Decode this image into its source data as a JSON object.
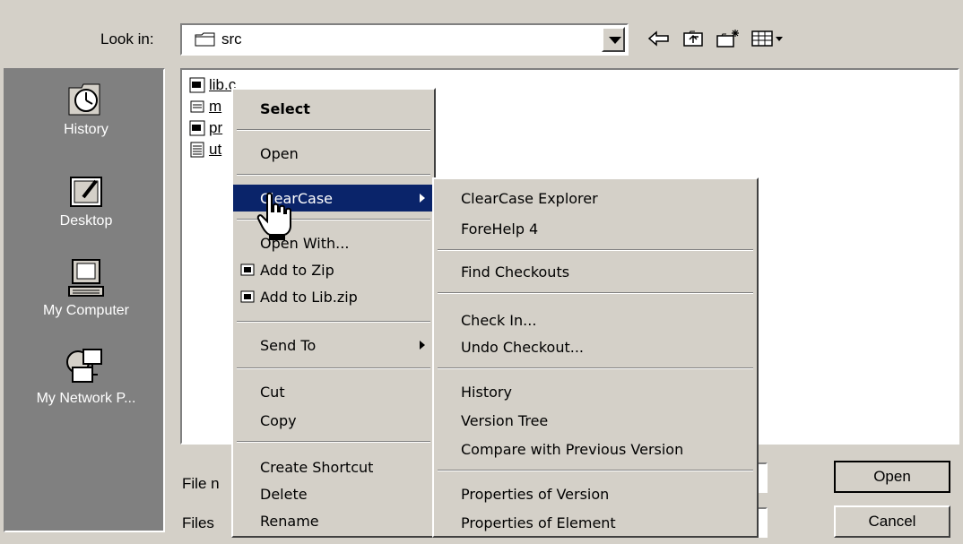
{
  "look_in": {
    "label": "Look in:",
    "value": "src"
  },
  "toolbar_icons": [
    "back-arrow-icon",
    "up-folder-icon",
    "new-folder-icon",
    "view-menu-icon"
  ],
  "places": [
    {
      "label": "History",
      "icon": "history-icon"
    },
    {
      "label": "Desktop",
      "icon": "desktop-icon"
    },
    {
      "label": "My Computer",
      "icon": "my-computer-icon"
    },
    {
      "label": "My Network P...",
      "icon": "network-places-icon"
    }
  ],
  "files": [
    {
      "name": "lib.c"
    },
    {
      "name": "m"
    },
    {
      "name": "pr"
    },
    {
      "name": "ut"
    }
  ],
  "bottom": {
    "filename_label": "File n",
    "filetype_label": "Files",
    "open_label": "Open",
    "cancel_label": "Cancel"
  },
  "context_menu": {
    "items": [
      {
        "label": "Select"
      },
      {
        "label": "Open"
      },
      {
        "label": "ClearCase"
      },
      {
        "label": "Open With..."
      },
      {
        "label": "Add to Zip"
      },
      {
        "label": "Add to Lib.zip"
      },
      {
        "label": "Send To"
      },
      {
        "label": "Cut"
      },
      {
        "label": "Copy"
      },
      {
        "label": "Create Shortcut"
      },
      {
        "label": "Delete"
      },
      {
        "label": "Rename"
      }
    ]
  },
  "clearcase_submenu": {
    "items": [
      {
        "label": "ClearCase Explorer"
      },
      {
        "label": "ForeHelp 4"
      },
      {
        "label": "Find Checkouts"
      },
      {
        "label": "Check In..."
      },
      {
        "label": "Undo Checkout..."
      },
      {
        "label": "History"
      },
      {
        "label": "Version Tree"
      },
      {
        "label": "Compare with Previous Version"
      },
      {
        "label": "Properties of Version"
      },
      {
        "label": "Properties of Element"
      }
    ]
  },
  "colors": {
    "face": "#d4d0c8",
    "highlight": "#0a246a",
    "places_bg": "#808080"
  }
}
